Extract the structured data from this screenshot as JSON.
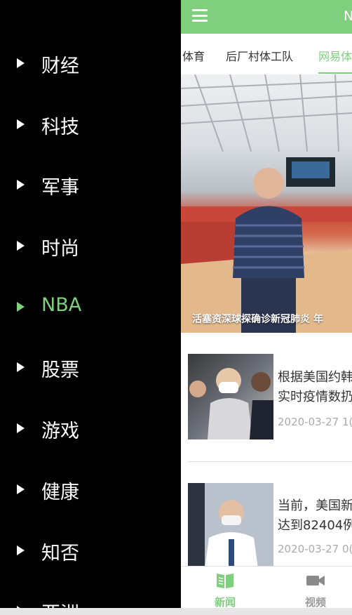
{
  "app": {
    "title": "N",
    "accent": "#7fcf7f",
    "drawer_bg": "#000000"
  },
  "tabs": [
    {
      "label": "体育"
    },
    {
      "label": "后厂村体工队"
    },
    {
      "label": "网易体"
    }
  ],
  "hero": {
    "caption": "活塞资深球探确诊新冠肺炎 年"
  },
  "news": [
    {
      "title_line1": "根据美国约韩",
      "title_line2": "实时疫情数扔",
      "time": "2020-03-27 1("
    },
    {
      "title_line1": "当前，美国新",
      "title_line2": "达到82404例",
      "time": "2020-03-27 0("
    }
  ],
  "bottom_nav": [
    {
      "label": "新闻",
      "icon": "book-icon",
      "active": true
    },
    {
      "label": "视频",
      "icon": "video-camera-icon",
      "active": false
    }
  ],
  "drawer": {
    "items": [
      {
        "label": "财经"
      },
      {
        "label": "科技"
      },
      {
        "label": "军事"
      },
      {
        "label": "时尚"
      },
      {
        "label": "NBA",
        "active": true
      },
      {
        "label": "股票"
      },
      {
        "label": "游戏"
      },
      {
        "label": "健康"
      },
      {
        "label": "知否"
      },
      {
        "label": "亚洲"
      }
    ]
  }
}
